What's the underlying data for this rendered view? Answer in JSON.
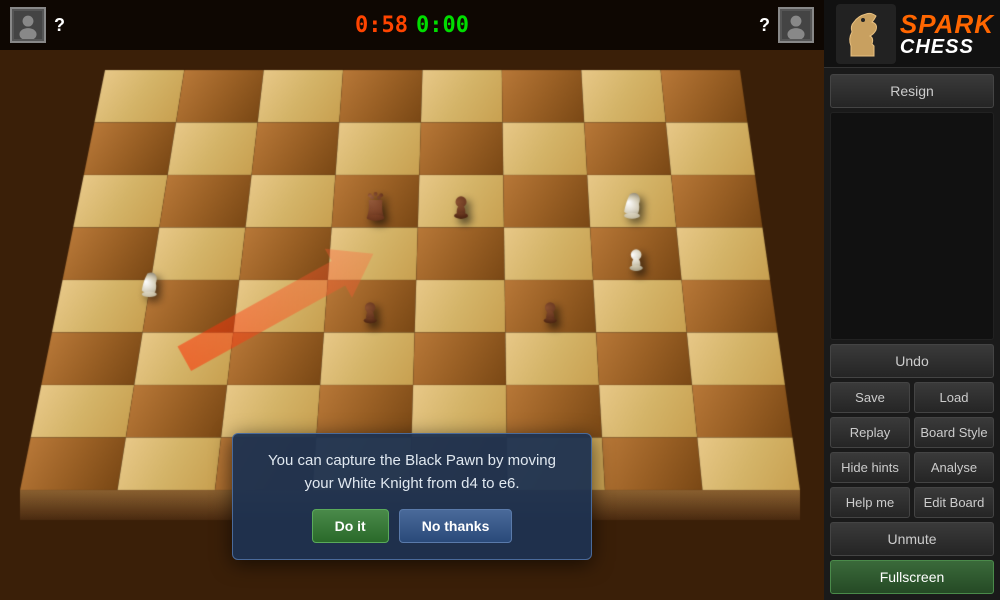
{
  "header": {
    "player1": {
      "name": "?",
      "timer": "0:58",
      "timer_color": "red"
    },
    "player2": {
      "name": "?",
      "timer": "0:00",
      "timer_color": "green"
    }
  },
  "dialog": {
    "message": "You can capture the Black Pawn by moving your White Knight from d4 to e6.",
    "btn_do_it": "Do it",
    "btn_no_thanks": "No thanks"
  },
  "sidebar": {
    "title_spark": "SPARK",
    "title_chess": "CHESS",
    "btn_resign": "Resign",
    "btn_undo": "Undo",
    "btn_save": "Save",
    "btn_load": "Load",
    "btn_replay": "Replay",
    "btn_board_style": "Board Style",
    "btn_hide_hints": "Hide hints",
    "btn_analyse": "Analyse",
    "btn_help_me": "Help me",
    "btn_edit_board": "Edit Board",
    "btn_unmute": "Unmute",
    "btn_fullscreen": "Fullscreen"
  }
}
